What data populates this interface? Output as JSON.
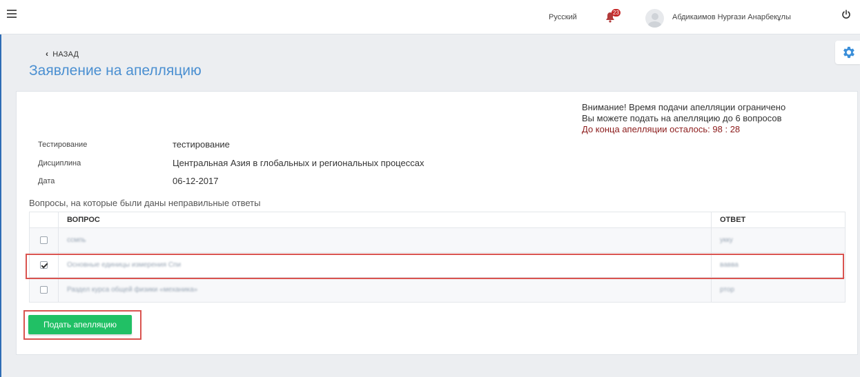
{
  "header": {
    "language": "Русский",
    "notifications_count": "23",
    "user_name": "Абдикаимов Нурғази Анарбекұлы"
  },
  "nav": {
    "back_label": "НАЗАД"
  },
  "page": {
    "title": "Заявление на апелляцию"
  },
  "notice": {
    "line1": "Внимание! Время подачи апелляции ограничено",
    "line2": "Вы можете подать на апелляцию до 6 вопросов",
    "timer_text": "До конца апелляции осталось: 98 : 28"
  },
  "info": {
    "rows": [
      {
        "label": "Тестирование",
        "value": "тестирование"
      },
      {
        "label": "Дисциплина",
        "value": "Центральная Азия в глобальных и региональных процессах"
      },
      {
        "label": "Дата",
        "value": "06-12-2017"
      }
    ]
  },
  "table": {
    "section_title": "Вопросы, на которые были даны неправильные ответы",
    "headers": {
      "question": "ВОПРОС",
      "answer": "ОТВЕТ"
    },
    "rows": [
      {
        "question": "ссмпь",
        "answer": "укку",
        "checked": false
      },
      {
        "question": "Основные единицы измерения Спи",
        "answer": "вавва",
        "checked": true
      },
      {
        "question": "Раздел курса общей физики «механика»",
        "answer": "ртор",
        "checked": false
      }
    ]
  },
  "actions": {
    "submit_label": "Подать апелляцию"
  },
  "colors": {
    "accent_blue": "#4a8fd1",
    "submit_green": "#21c065",
    "highlight_red": "#d9534f",
    "timer_red": "#8b1a1a"
  }
}
